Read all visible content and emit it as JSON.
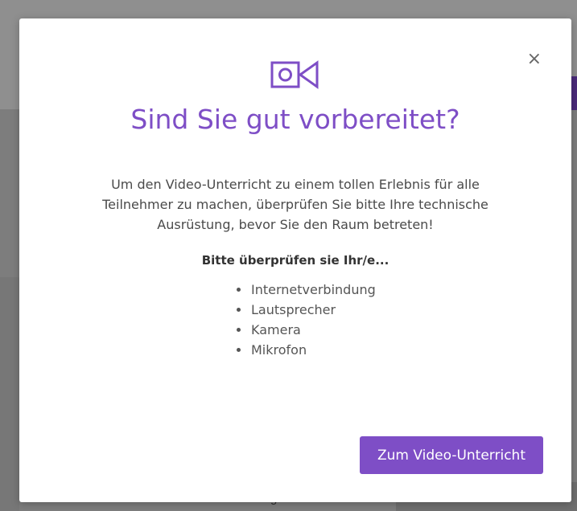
{
  "background": {
    "partial_text": "g"
  },
  "modal": {
    "title": "Sind Sie gut vorbereitet?",
    "close_label": "×",
    "intro_text": "Um den Video-Unterricht zu einem tollen Erlebnis für alle Teilnehmer zu machen, überprüfen Sie bitte Ihre technische Ausrüstung, bevor Sie den Raum betreten!",
    "checklist_heading": "Bitte überprüfen sie Ihr/e...",
    "checklist_items": [
      {
        "label": "Internetverbindung"
      },
      {
        "label": "Lautsprecher"
      },
      {
        "label": "Kamera"
      },
      {
        "label": "Mikrofon"
      }
    ],
    "primary_button_label": "Zum Video-Unterricht",
    "icon": "video-camera-icon"
  },
  "colors": {
    "accent": "#7e4ec6",
    "text": "#4a4a4a"
  }
}
